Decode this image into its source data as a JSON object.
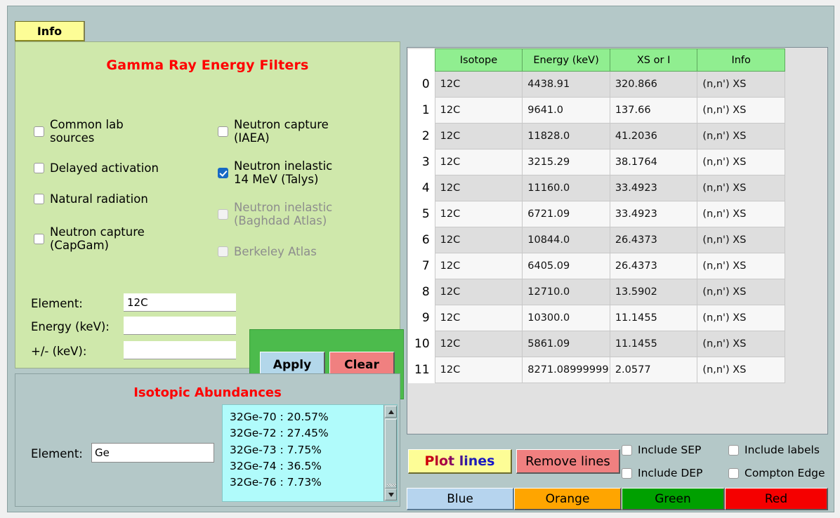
{
  "tab": {
    "info_label": "Info"
  },
  "filters": {
    "title": "Gamma Ray Energy Filters",
    "checkboxes_left": [
      {
        "label": "Common lab\nsources",
        "checked": false,
        "disabled": false
      },
      {
        "label": "Delayed activation",
        "checked": false,
        "disabled": false
      },
      {
        "label": "Natural radiation",
        "checked": false,
        "disabled": false
      },
      {
        "label": "Neutron capture\n(CapGam)",
        "checked": false,
        "disabled": false
      }
    ],
    "checkboxes_right": [
      {
        "label": "Neutron capture\n(IAEA)",
        "checked": false,
        "disabled": false
      },
      {
        "label": "Neutron inelastic\n14 MeV (Talys)",
        "checked": true,
        "disabled": false
      },
      {
        "label": "Neutron inelastic\n(Baghdad Atlas)",
        "checked": false,
        "disabled": true
      },
      {
        "label": "Berkeley Atlas",
        "checked": false,
        "disabled": true
      }
    ],
    "form": {
      "element_label": "Element:",
      "element_value": "12C",
      "energy_label": "Energy (keV):",
      "energy_value": "",
      "tolerance_label": "+/- (keV):",
      "tolerance_value": "",
      "apply_label": "Apply",
      "clear_label": "Clear"
    }
  },
  "abundances": {
    "title": "Isotopic Abundances",
    "element_label": "Element:",
    "element_value": "Ge",
    "list_text": "32Ge-70 : 20.57%\n32Ge-72 : 27.45%\n32Ge-73 : 7.75%\n32Ge-74 : 36.5%\n32Ge-76 : 7.73%"
  },
  "table": {
    "columns": [
      "Isotope",
      "Energy (keV)",
      "XS or I",
      "Info"
    ],
    "sort_indicator": "chevron-down",
    "rows": [
      {
        "index": "0",
        "isotope": "12C",
        "energy": "4438.91",
        "xs": "320.866",
        "info": "(n,n') XS"
      },
      {
        "index": "1",
        "isotope": "12C",
        "energy": "9641.0",
        "xs": "137.66",
        "info": "(n,n') XS"
      },
      {
        "index": "2",
        "isotope": "12C",
        "energy": "11828.0",
        "xs": "41.2036",
        "info": "(n,n') XS"
      },
      {
        "index": "3",
        "isotope": "12C",
        "energy": "3215.29",
        "xs": "38.1764",
        "info": "(n,n') XS"
      },
      {
        "index": "4",
        "isotope": "12C",
        "energy": "11160.0",
        "xs": "33.4923",
        "info": "(n,n') XS"
      },
      {
        "index": "5",
        "isotope": "12C",
        "energy": "6721.09",
        "xs": "33.4923",
        "info": "(n,n') XS"
      },
      {
        "index": "6",
        "isotope": "12C",
        "energy": "10844.0",
        "xs": "26.4373",
        "info": "(n,n') XS"
      },
      {
        "index": "7",
        "isotope": "12C",
        "energy": "6405.09",
        "xs": "26.4373",
        "info": "(n,n') XS"
      },
      {
        "index": "8",
        "isotope": "12C",
        "energy": "12710.0",
        "xs": "13.5902",
        "info": "(n,n') XS"
      },
      {
        "index": "9",
        "isotope": "12C",
        "energy": "10300.0",
        "xs": "11.1455",
        "info": "(n,n') XS"
      },
      {
        "index": "10",
        "isotope": "12C",
        "energy": "5861.09",
        "xs": "11.1455",
        "info": "(n,n') XS"
      },
      {
        "index": "11",
        "isotope": "12C",
        "energy": "8271.08999999…",
        "xs": "2.0577",
        "info": "(n,n') XS"
      }
    ]
  },
  "actions": {
    "plot_lines_label": "Plot lines",
    "remove_lines_label": "Remove lines",
    "options": [
      {
        "label": "Include SEP",
        "checked": false
      },
      {
        "label": "Include labels",
        "checked": false
      },
      {
        "label": "Include DEP",
        "checked": false
      },
      {
        "label": "Compton Edge",
        "checked": false
      }
    ],
    "color_buttons": [
      {
        "label": "Blue",
        "color": "#b6d4ee"
      },
      {
        "label": "Orange",
        "color": "#ffa500"
      },
      {
        "label": "Green",
        "color": "#00a000"
      },
      {
        "label": "Red",
        "color": "#f50000"
      }
    ]
  },
  "colors": {
    "window_bg": "#b4c8c8",
    "filters_bg": "#cfe8ab",
    "accent_red": "#ff0000",
    "header_green": "#90ee90",
    "apply_panel_green": "#4cbb4c",
    "list_cyan": "#b0fbfb",
    "tab_yellow": "#fdfd96"
  }
}
